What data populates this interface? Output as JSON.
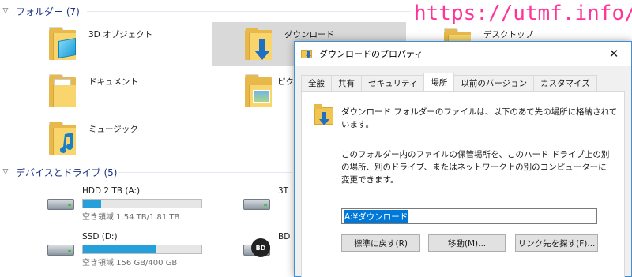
{
  "watermark": "https://utmf.info/",
  "explorer": {
    "folders_header": "フォルダー (7)",
    "devices_header": "デバイスとドライブ (5)",
    "folders": [
      {
        "name": "3D オブジェクト",
        "icon": "3d-objects-icon"
      },
      {
        "name": "ダウンロード",
        "icon": "download-folder-icon"
      },
      {
        "name": "デスクトップ",
        "icon": "desktop-folder-icon"
      },
      {
        "name": "ドキュメント",
        "icon": "documents-folder-icon"
      },
      {
        "name": "ピク",
        "icon": "pictures-folder-icon"
      },
      {
        "name": "ミュージック",
        "icon": "music-folder-icon"
      }
    ],
    "drives": [
      {
        "name": "HDD 2 TB (A:)",
        "free": "空き領域 1.54 TB/1.81 TB",
        "used_fraction": 0.15
      },
      {
        "name": "SSD (D:)",
        "free": "空き領域 156 GB/400 GB",
        "used_fraction": 0.61
      },
      {
        "name": "3T",
        "free": "",
        "used_fraction": 0.0
      },
      {
        "name": "BD",
        "free": "",
        "used_fraction": 0.0
      }
    ]
  },
  "dialog": {
    "title": "ダウンロードのプロパティ",
    "close_glyph": "✕",
    "tabs": [
      "全般",
      "共有",
      "セキュリティ",
      "場所",
      "以前のバージョン",
      "カスタマイズ"
    ],
    "active_tab_index": 3,
    "description1": "ダウンロード フォルダーのファイルは、以下のあて先の場所に格納されています。",
    "description2": "このフォルダー内のファイルの保管場所を、このハード ドライブ上の別の場所、別のドライブ、またはネットワーク上の別のコンピューターに変更できます。",
    "path_value": "A:¥ダウンロード",
    "buttons": {
      "restore": "標準に戻す(R)",
      "move": "移動(M)...",
      "find_target": "リンク先を探す(F)..."
    }
  },
  "colors": {
    "accent": "#0078d7",
    "group_header": "#1e3287",
    "drive_bar": "#26a0da",
    "folder": "#f9d66d",
    "watermark": "#ff3399"
  }
}
